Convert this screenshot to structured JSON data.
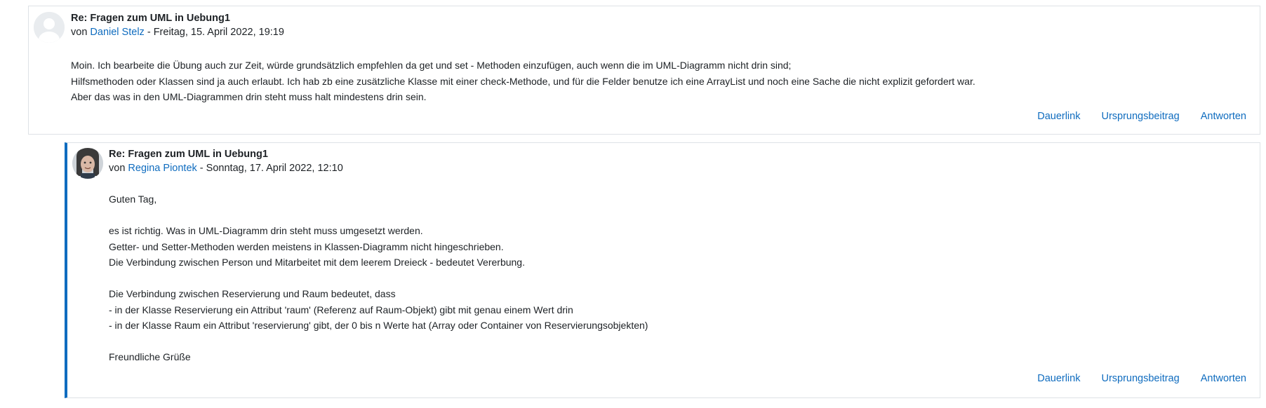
{
  "posts": [
    {
      "subject": "Re: Fragen zum UML in Uebung1",
      "by_prefix": "von",
      "author": "Daniel Stelz",
      "date_separator": "-",
      "date": "Freitag, 15. April 2022, 19:19",
      "lines": [
        "Moin. Ich bearbeite die Übung auch zur Zeit, würde grundsätzlich empfehlen da get und set - Methoden einzufügen, auch wenn die im UML-Diagramm nicht drin sind;",
        "Hilfsmethoden oder Klassen sind ja auch erlaubt. Ich hab zb eine zusätzliche Klasse mit einer check-Methode, und für die Felder benutze ich eine ArrayList und noch eine Sache die nicht explizit gefordert war.",
        "Aber das was in den UML-Diagrammen drin steht muss halt mindestens drin sein."
      ],
      "actions": {
        "permalink": "Dauerlink",
        "parent": "Ursprungsbeitrag",
        "reply": "Antworten"
      }
    },
    {
      "subject": "Re: Fragen zum UML in Uebung1",
      "by_prefix": "von",
      "author": "Regina Piontek",
      "date_separator": "-",
      "date": "Sonntag, 17. April 2022, 12:10",
      "lines": [
        "Guten Tag,",
        "",
        "es ist richtig. Was in UML-Diagramm drin steht muss umgesetzt werden.",
        "Getter- und Setter-Methoden werden meistens in Klassen-Diagramm nicht hingeschrieben.",
        "Die Verbindung zwischen Person und Mitarbeitet mit dem leerem Dreieck - bedeutet Vererbung.",
        "",
        "Die Verbindung zwischen Reservierung und Raum bedeutet, dass",
        "- in der Klasse Reservierung ein Attribut 'raum' (Referenz auf Raum-Objekt) gibt mit genau einem Wert drin",
        "- in der Klasse Raum ein Attribut 'reservierung' gibt, der 0 bis n Werte hat (Array oder Container von Reservierungsobjekten)",
        "",
        "Freundliche Grüße"
      ],
      "actions": {
        "permalink": "Dauerlink",
        "parent": "Ursprungsbeitrag",
        "reply": "Antworten"
      }
    }
  ],
  "colors": {
    "link": "#0f6cbf",
    "reply_border": "#0f6cbf",
    "text": "#1d2125",
    "border": "#dee2e6"
  },
  "icons": [
    "default-user-avatar",
    "user-photo-avatar"
  ]
}
